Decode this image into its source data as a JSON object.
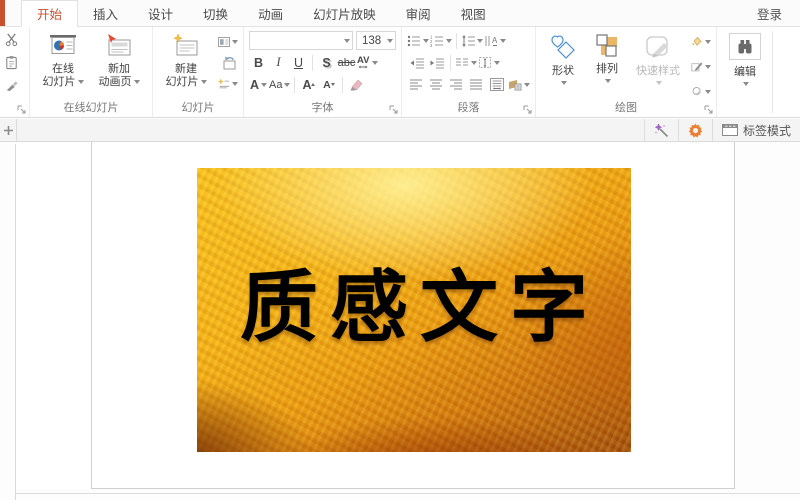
{
  "window": {
    "login_label": "登录"
  },
  "tabs": {
    "items": [
      {
        "label": "开始"
      },
      {
        "label": "插入"
      },
      {
        "label": "设计"
      },
      {
        "label": "切换"
      },
      {
        "label": "动画"
      },
      {
        "label": "幻灯片放映"
      },
      {
        "label": "审阅"
      },
      {
        "label": "视图"
      }
    ]
  },
  "ribbon": {
    "online_slides": {
      "group_label": "在线幻灯片",
      "online_line1": "在线",
      "online_line2": "幻灯片",
      "addanim_line1": "新加",
      "addanim_line2": "动画页"
    },
    "slides": {
      "group_label": "幻灯片",
      "new_line1": "新建",
      "new_line2": "幻灯片"
    },
    "font": {
      "group_label": "字体",
      "name_value": "",
      "size_value": "138",
      "bold": "B",
      "italic": "I",
      "underline": "U",
      "shadow": "S",
      "strikethrough": "abc",
      "char_spacing": "AV",
      "font_color": "A",
      "change_case": "Aa",
      "grow_font": "A",
      "shrink_font": "A"
    },
    "paragraph": {
      "group_label": "段落"
    },
    "drawing": {
      "group_label": "绘图",
      "shapes_label": "形状",
      "arrange_label": "排列",
      "quick_styles_label": "快速样式"
    },
    "edit": {
      "group_label": "编辑"
    }
  },
  "tabbar": {
    "tab_mode_label": "标签模式"
  },
  "slide": {
    "text": "质感文字"
  },
  "colors": {
    "accent": "#c8502e",
    "gold_bright": "#f6b312",
    "gold_dark": "#9c4707",
    "wand_purple": "#9b59b6",
    "gear_orange": "#ed7d31"
  }
}
